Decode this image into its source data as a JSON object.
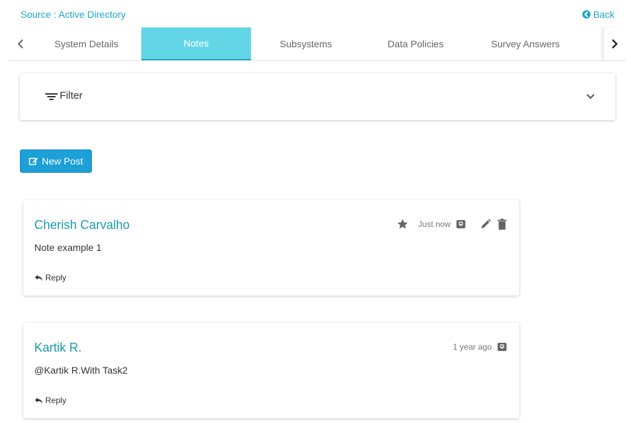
{
  "header": {
    "source": "Source : Active Directory",
    "back_label": "Back"
  },
  "tabs": [
    {
      "label": "System Details",
      "active": false
    },
    {
      "label": "Notes",
      "active": true
    },
    {
      "label": "Subsystems",
      "active": false
    },
    {
      "label": "Data Policies",
      "active": false
    },
    {
      "label": "Survey Answers",
      "active": false
    }
  ],
  "filter": {
    "label": "Filter"
  },
  "new_post": {
    "label": "New Post"
  },
  "posts": [
    {
      "author": "Cherish Carvalho",
      "time": "Just now",
      "content": "Note example 1",
      "reply_label": "Reply"
    },
    {
      "author": "Kartik R.",
      "time": "1 year ago",
      "content": "@Kartik R.With Task2",
      "reply_label": "Reply"
    }
  ],
  "colors": {
    "accent": "#1aa6c9",
    "active_tab": "#63d6e6",
    "button": "#1d9fd8",
    "author": "#1a9bab"
  },
  "icons": [
    "back-icon",
    "chevron-left-icon",
    "chevron-right-icon",
    "filter-icon",
    "chevron-down-icon",
    "edit-icon",
    "star-icon",
    "archive-icon",
    "pencil-icon",
    "trash-icon",
    "reply-icon"
  ]
}
